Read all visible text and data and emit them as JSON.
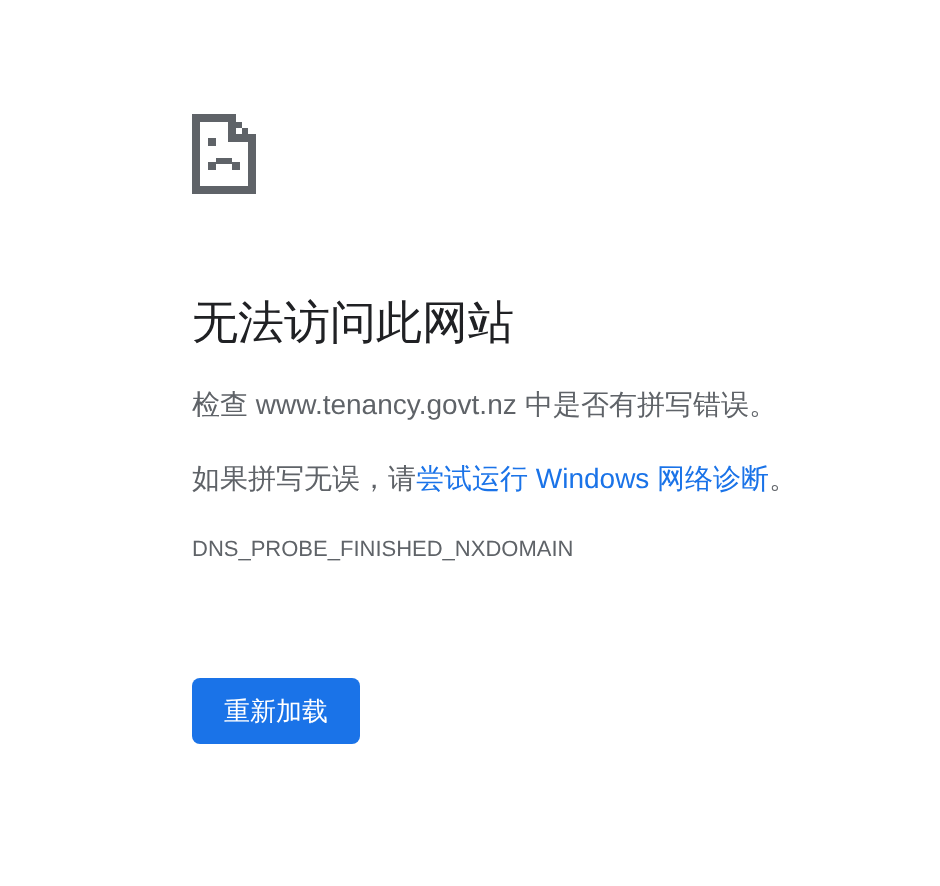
{
  "heading": "无法访问此网站",
  "check_line": "检查 www.tenancy.govt.nz 中是否有拼写错误。",
  "suggestion": {
    "before": "如果拼写无误，请",
    "link": "尝试运行 Windows 网络诊断",
    "after": "。"
  },
  "error_code": "DNS_PROBE_FINISHED_NXDOMAIN",
  "reload_button": "重新加载"
}
